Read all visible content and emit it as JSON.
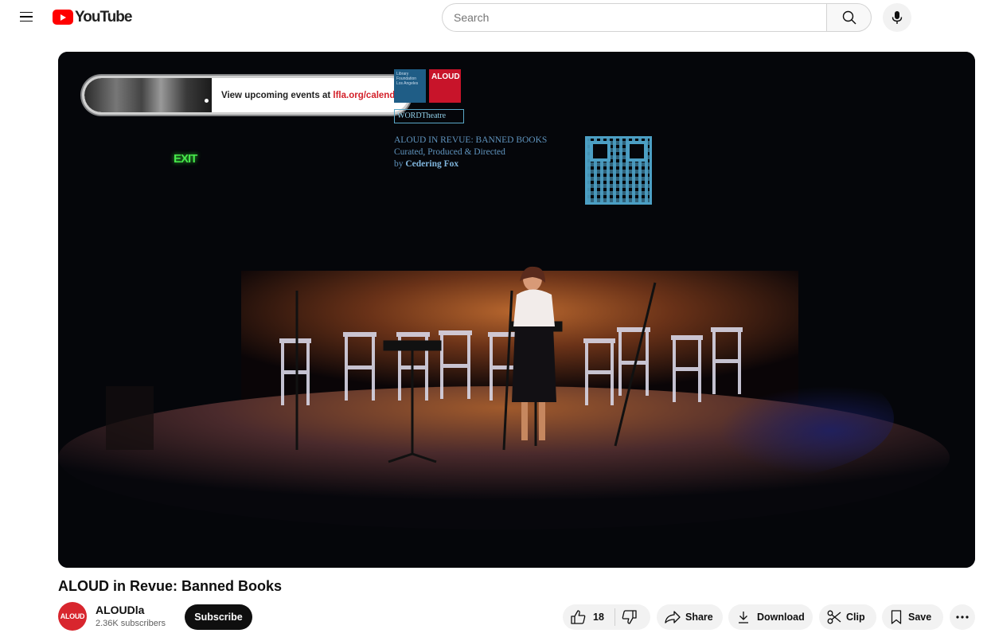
{
  "header": {
    "logo_text": "YouTube",
    "search_placeholder": "Search",
    "search_icon": "search-icon",
    "mic_icon": "microphone-icon",
    "menu_icon": "hamburger-menu-icon"
  },
  "player": {
    "overlay": {
      "promo_text": "View upcoming events at ",
      "promo_link": "lfla.org/calendar"
    },
    "screen": {
      "logo_left_text": "Library Foundation Los Angeles",
      "logo_right_text": "ALOUD",
      "word_theatre": "WORDTheatre",
      "line1": "ALOUD IN REVUE: BANNED BOOKS",
      "line2": "Curated, Produced & Directed",
      "line3_prefix": "by ",
      "line3_name": "Cedering Fox"
    },
    "exit_sign": "EXIT"
  },
  "video": {
    "title": "ALOUD in Revue: Banned Books"
  },
  "channel": {
    "avatar_text": "ALOUD",
    "name": "ALOUDla",
    "subscribers": "2.36K subscribers",
    "subscribe_label": "Subscribe"
  },
  "actions": {
    "like_count": "18",
    "share_label": "Share",
    "download_label": "Download",
    "clip_label": "Clip",
    "save_label": "Save"
  },
  "colors": {
    "brand_red": "#ff0000",
    "subscribe_bg": "#0f0f0f",
    "pill_bg": "#f2f2f2",
    "promo_link": "#d3212a"
  }
}
